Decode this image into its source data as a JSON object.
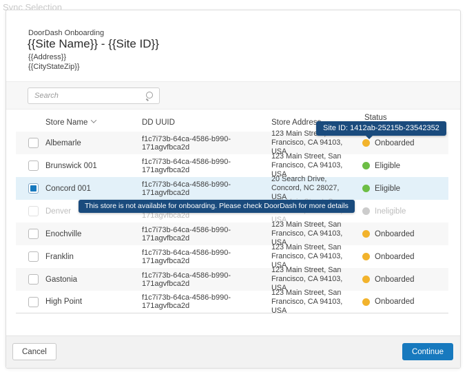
{
  "page_title": "Sync Selection",
  "modal": {
    "header": {
      "eyebrow": "DoorDash Onboarding",
      "title": "{{Site Name}} - {{Site ID}}",
      "address": "{{Address}}",
      "city_state_zip": "{{CityStateZip}}"
    },
    "search": {
      "placeholder": "Search",
      "value": ""
    },
    "table": {
      "columns": [
        "Store Name",
        "DD UUID",
        "Store Address",
        "Status"
      ],
      "rows": [
        {
          "name": "Albemarle",
          "uuid": "f1c7i73b-64ca-4586-b990-171agvfbca2d",
          "address": "123 Main Street, San Francisco, CA 94103, USA",
          "status": "Onboarded",
          "checked": false,
          "selected": false,
          "disabled": false
        },
        {
          "name": "Brunswick 001",
          "uuid": "f1c7i73b-64ca-4586-b990-171agvfbca2d",
          "address": "123 Main Street, San Francisco, CA 94103, USA",
          "status": "Eligible",
          "checked": false,
          "selected": false,
          "disabled": false
        },
        {
          "name": "Concord 001",
          "uuid": "f1c7i73b-64ca-4586-b990-171agvfbca2d",
          "address": "20 Search Drive, Concord, NC 28027, USA",
          "status": "Eligible",
          "checked": true,
          "selected": true,
          "disabled": false
        },
        {
          "name": "Denver",
          "uuid": "f1c7i73b-64ca-4586-b990-171agvfbca2d",
          "address": "123 Main Street, San Francisco, CA 94103, USA",
          "status": "Ineligible",
          "checked": false,
          "selected": false,
          "disabled": true
        },
        {
          "name": "Enochville",
          "uuid": "f1c7i73b-64ca-4586-b990-171agvfbca2d",
          "address": "123 Main Street, San Francisco, CA 94103, USA",
          "status": "Onboarded",
          "checked": false,
          "selected": false,
          "disabled": false
        },
        {
          "name": "Franklin",
          "uuid": "f1c7i73b-64ca-4586-b990-171agvfbca2d",
          "address": "123 Main Street, San Francisco, CA 94103, USA",
          "status": "Onboarded",
          "checked": false,
          "selected": false,
          "disabled": false
        },
        {
          "name": "Gastonia",
          "uuid": "f1c7i73b-64ca-4586-b990-171agvfbca2d",
          "address": "123 Main Street, San Francisco, CA 94103, USA",
          "status": "Onboarded",
          "checked": false,
          "selected": false,
          "disabled": false
        },
        {
          "name": "High Point",
          "uuid": "f1c7i73b-64ca-4586-b990-171agvfbca2d",
          "address": "123 Main Street, San Francisco, CA 94103, USA",
          "status": "Onboarded",
          "checked": false,
          "selected": false,
          "disabled": false
        }
      ]
    },
    "tooltips": {
      "site_id": "Site ID: 1412ab-25215b-23542352",
      "unavailable": "This store is not available for onboarding.  Please check DoorDash for more details"
    },
    "footer": {
      "cancel_label": "Cancel",
      "continue_label": "Continue"
    }
  },
  "colors": {
    "status_onboarded": "#F2B32C",
    "status_eligible": "#6DBE45",
    "status_ineligible": "#CCCCCC",
    "accent_blue": "#1779BE",
    "tooltip_bg": "#1A4B7D",
    "selected_row_bg": "#E3F1F9"
  }
}
